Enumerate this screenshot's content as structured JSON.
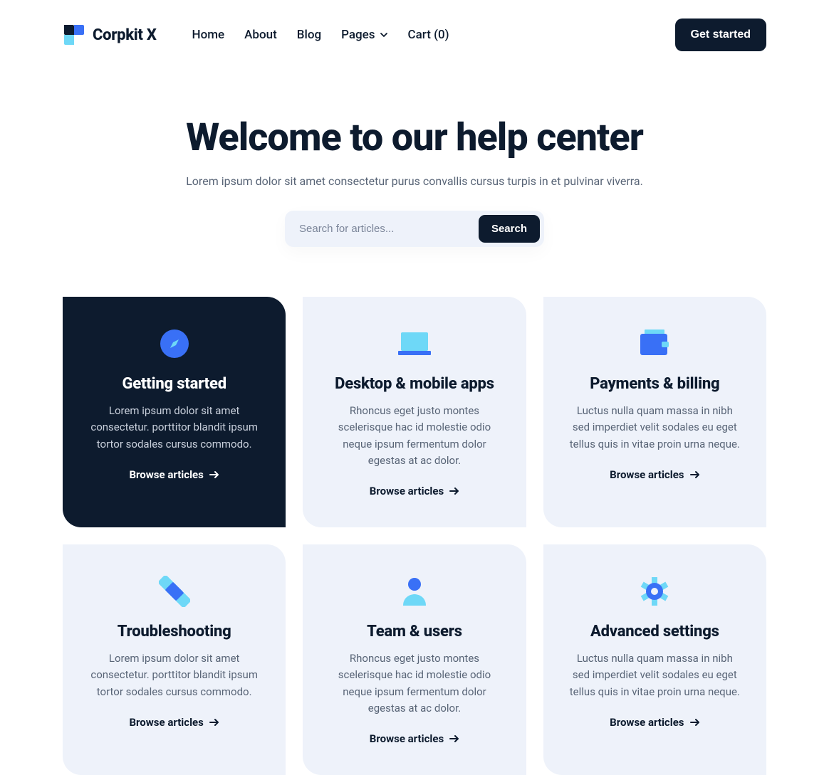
{
  "brand": {
    "name": "Corpkit X"
  },
  "nav": {
    "items": [
      {
        "label": "Home"
      },
      {
        "label": "About"
      },
      {
        "label": "Blog"
      },
      {
        "label": "Pages"
      },
      {
        "label": "Cart (0)"
      }
    ],
    "cta": "Get started"
  },
  "hero": {
    "title": "Welcome to our help center",
    "subtitle": "Lorem ipsum dolor sit amet consectetur purus convallis cursus turpis in et pulvinar viverra.",
    "search": {
      "placeholder": "Search for articles...",
      "button": "Search"
    }
  },
  "cards": [
    {
      "title": "Getting started",
      "desc": "Lorem ipsum dolor sit amet consectetur. porttitor blandit ipsum tortor sodales cursus commodo.",
      "link": "Browse articles",
      "icon": "compass-icon"
    },
    {
      "title": "Desktop & mobile apps",
      "desc": "Rhoncus eget justo montes scelerisque hac id molestie odio neque ipsum fermentum dolor egestas at ac dolor.",
      "link": "Browse articles",
      "icon": "monitor-icon"
    },
    {
      "title": "Payments & billing",
      "desc": "Luctus nulla quam massa in nibh sed imperdiet velit sodales eu eget tellus quis in vitae proin urna neque.",
      "link": "Browse articles",
      "icon": "wallet-icon"
    },
    {
      "title": "Troubleshooting",
      "desc": "Lorem ipsum dolor sit amet consectetur. porttitor blandit ipsum tortor sodales cursus commodo.",
      "link": "Browse articles",
      "icon": "bandage-icon"
    },
    {
      "title": "Team & users",
      "desc": "Rhoncus eget justo montes scelerisque hac id molestie odio neque ipsum fermentum dolor egestas at ac dolor.",
      "link": "Browse articles",
      "icon": "user-icon"
    },
    {
      "title": "Advanced settings",
      "desc": "Luctus nulla quam massa in nibh sed imperdiet velit sodales eu eget tellus quis in vitae proin urna neque.",
      "link": "Browse articles",
      "icon": "gear-icon"
    }
  ],
  "colors": {
    "accentBlue": "#3970f6",
    "accentLight": "#6ed8f7",
    "dark": "#0d1b2e",
    "soft": "#eef2fa"
  }
}
